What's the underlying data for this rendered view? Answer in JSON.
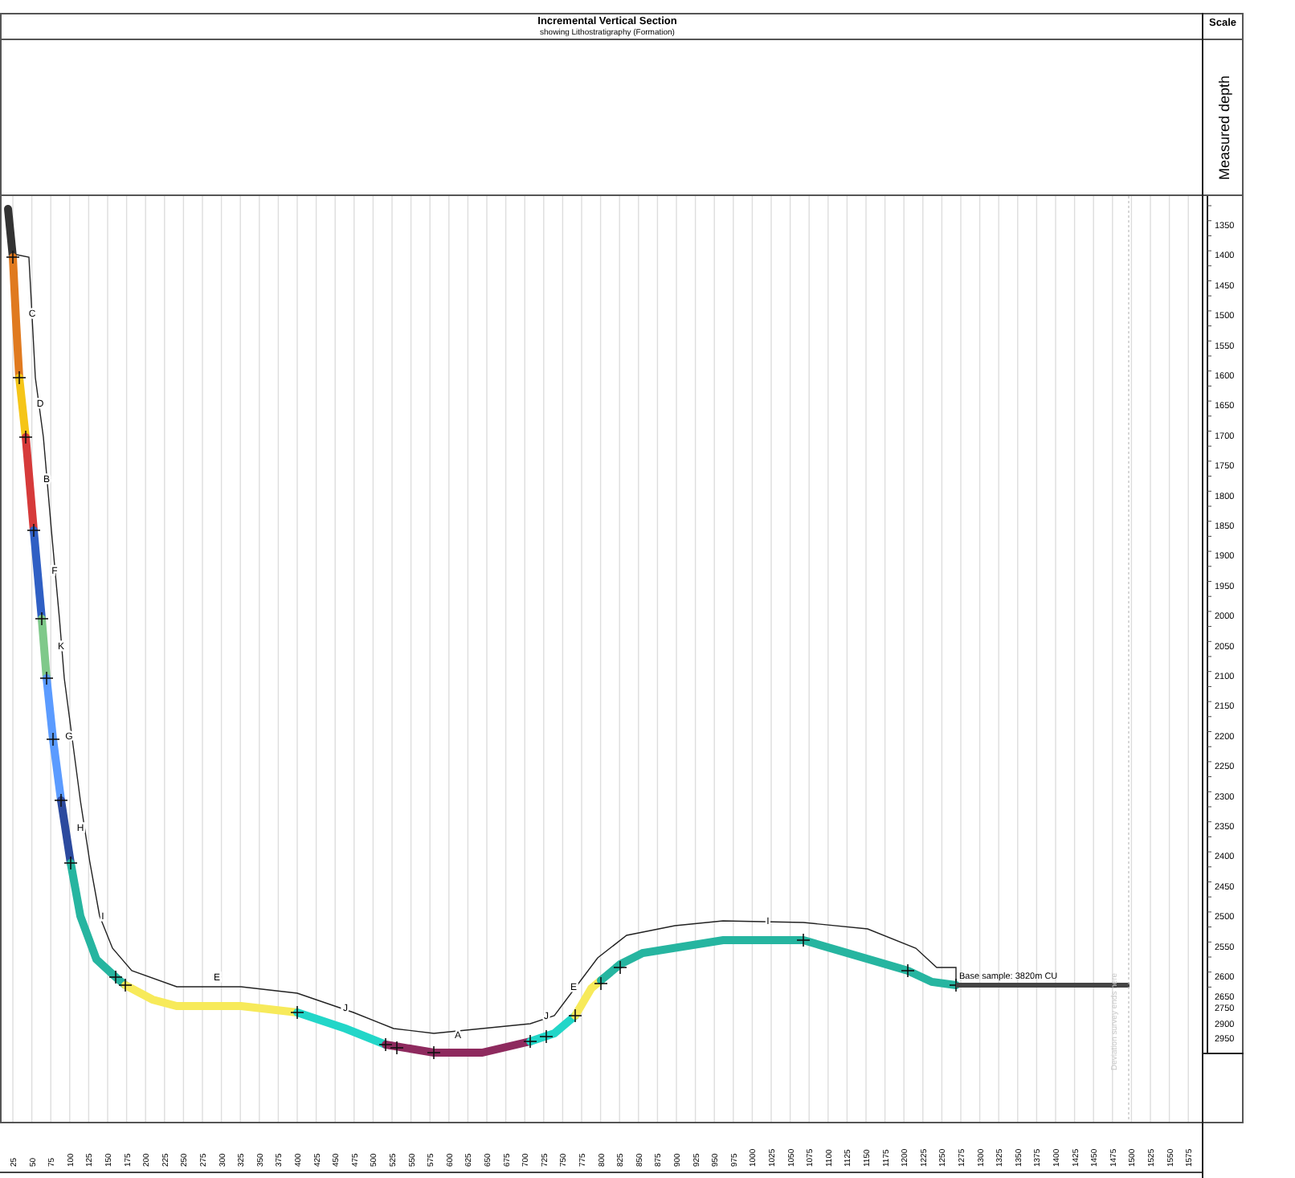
{
  "header": {
    "title": "Incremental Vertical Section",
    "subtitle": "showing Lithostratigraphy (Formation)"
  },
  "scale": {
    "title": "Scale",
    "axis_label": "Measured depth",
    "depth_ticks": [
      "1350",
      "1400",
      "1450",
      "1500",
      "1550",
      "1600",
      "1650",
      "1700",
      "1750",
      "1800",
      "1850",
      "1900",
      "1950",
      "2000",
      "2050",
      "2100",
      "2150",
      "2200",
      "2250",
      "2300",
      "2350",
      "2400",
      "2450",
      "2500",
      "2550",
      "2600",
      "2650",
      "2750",
      "2900",
      "2950"
    ]
  },
  "section": {
    "formations": [
      {
        "color": "#333333"
      },
      {
        "label": "C",
        "color": "#e07a1f"
      },
      {
        "label": "D",
        "color": "#f5c518"
      },
      {
        "label": "B",
        "color": "#d63a3a"
      },
      {
        "label": "F",
        "color": "#2f5fc4"
      },
      {
        "label": "K",
        "color": "#7fc98a"
      },
      {
        "label": "G",
        "color": "#5b9bff"
      },
      {
        "label": "H",
        "color": "#2c4a9e"
      },
      {
        "label": "I",
        "color": "#26b5a0"
      },
      {
        "label": "E",
        "color": "#f7ea5a"
      },
      {
        "label": "J",
        "color": "#22d6c8"
      },
      {
        "label": "A",
        "color": "#8e2a5e"
      },
      {
        "label": "J",
        "color": "#22d6c8"
      },
      {
        "label": "E",
        "color": "#f7ea5a"
      },
      {
        "label": "I",
        "color": "#26b5a0"
      }
    ],
    "base_sample": "Base sample: 3820m CU",
    "note": "Deviation survey ends here",
    "offset_ticks": [
      "25",
      "50",
      "75",
      "100",
      "125",
      "150",
      "175",
      "200",
      "225",
      "250",
      "275",
      "300",
      "325",
      "350",
      "375",
      "400",
      "425",
      "450",
      "475",
      "500",
      "525",
      "550",
      "575",
      "600",
      "625",
      "650",
      "675",
      "700",
      "725",
      "750",
      "775",
      "800",
      "825",
      "850",
      "875",
      "900",
      "925",
      "950",
      "975",
      "1000",
      "1025",
      "1050",
      "1075",
      "1100",
      "1125",
      "1150",
      "1175",
      "1200",
      "1225",
      "1250",
      "1275",
      "1300",
      "1325",
      "1350",
      "1375",
      "1400",
      "1425",
      "1450",
      "1475",
      "1500",
      "1525",
      "1550",
      "1575"
    ]
  }
}
